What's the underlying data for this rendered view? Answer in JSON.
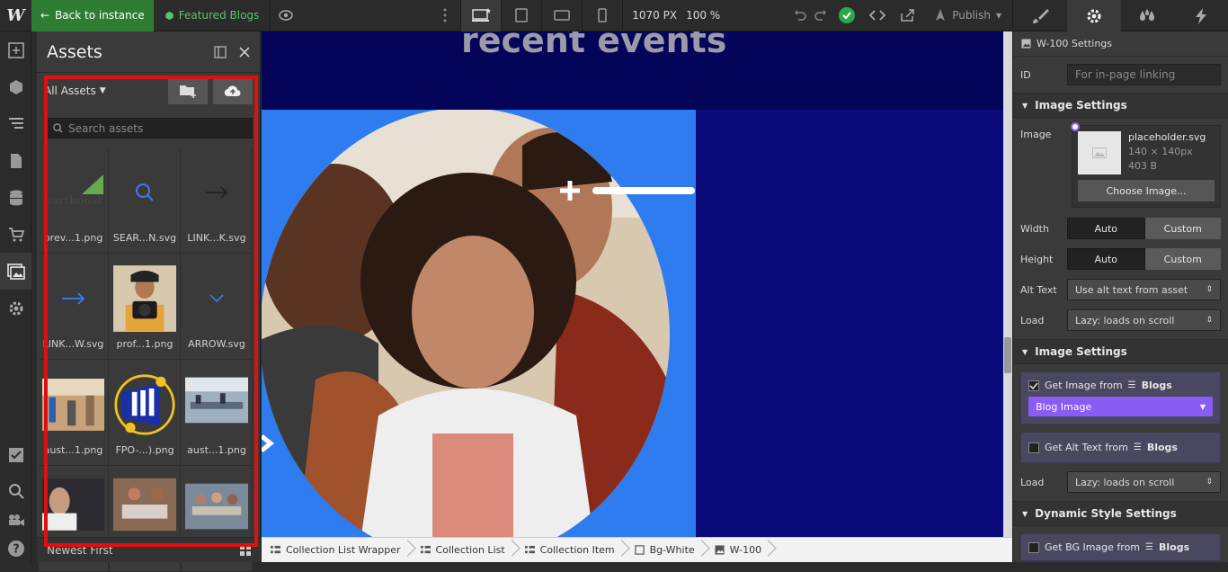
{
  "topbar": {
    "back_label": "Back to instance",
    "featured_label": "Featured Blogs",
    "width": "1070 PX",
    "zoom": "100 %",
    "publish": "Publish"
  },
  "assets": {
    "title": "Assets",
    "filter": "All Assets",
    "search_placeholder": "Search assets",
    "sort": "Newest First",
    "items": [
      {
        "name": "prev...1.png",
        "thumb": "chartboost"
      },
      {
        "name": "SEAR...N.svg",
        "thumb": "search"
      },
      {
        "name": "LINK...K.svg",
        "thumb": "arrow-dark"
      },
      {
        "name": "LINK...W.svg",
        "thumb": "arrow-blue"
      },
      {
        "name": "prof...1.png",
        "thumb": "photo-man"
      },
      {
        "name": "ARROW.svg",
        "thumb": "chevron"
      },
      {
        "name": "aust...1.png",
        "thumb": "photo-office"
      },
      {
        "name": "FPO-...).png",
        "thumb": "fpo"
      },
      {
        "name": "aust...1.png",
        "thumb": "photo-office2"
      },
      {
        "name": "",
        "thumb": "photo-a"
      },
      {
        "name": "",
        "thumb": "photo-b"
      },
      {
        "name": "",
        "thumb": "photo-c"
      }
    ],
    "chartboost_text": "Chartboost"
  },
  "canvas": {
    "heading": "recent events"
  },
  "breadcrumb": [
    "Collection List Wrapper",
    "Collection List",
    "Collection Item",
    "Bg-White",
    "W-100"
  ],
  "panel": {
    "settings_title": "W-100 Settings",
    "id_label": "ID",
    "id_placeholder": "For in-page linking",
    "image_settings": "Image Settings",
    "image_label": "Image",
    "file_name": "placeholder.svg",
    "file_dims": "140 × 140px",
    "file_size": "403 B",
    "choose_image": "Choose Image...",
    "width_label": "Width",
    "height_label": "Height",
    "auto": "Auto",
    "custom": "Custom",
    "alt_label": "Alt Text",
    "alt_value": "Use alt text from asset",
    "load_label": "Load",
    "load_value": "Lazy: loads on scroll",
    "image_settings2": "Image Settings",
    "get_image": "Get Image from",
    "blogs": "Blogs",
    "blog_image": "Blog Image",
    "get_alt": "Get Alt Text from",
    "dynamic_title": "Dynamic Style Settings",
    "get_bg": "Get BG Image from"
  },
  "colors": {
    "accent_green": "#2e7d32",
    "purple": "#8a5cf5",
    "canvas_blue": "#2f7bf0",
    "navy": "#0a0a7a"
  }
}
